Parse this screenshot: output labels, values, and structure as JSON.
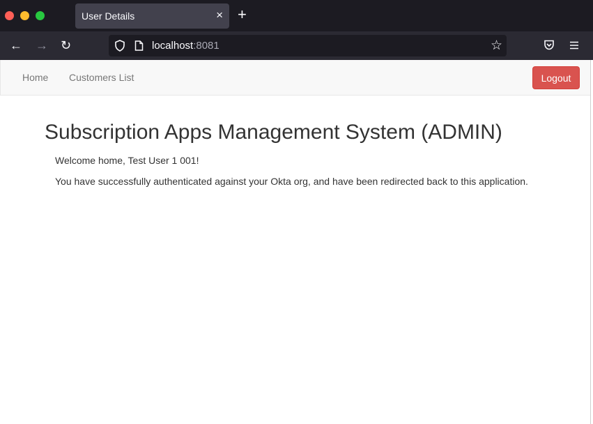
{
  "browser": {
    "tab_title": "User Details",
    "close_glyph": "×",
    "new_tab_glyph": "+",
    "url_host": "localhost",
    "url_port": ":8081",
    "back_glyph": "←",
    "forward_glyph": "→",
    "reload_glyph": "↻",
    "star_glyph": "☆",
    "icons": [
      "back-icon",
      "forward-icon",
      "reload-icon",
      "shield-icon",
      "page-icon",
      "star-icon",
      "pocket-icon",
      "menu-icon"
    ]
  },
  "nav": {
    "home": "Home",
    "customers": "Customers List",
    "logout": "Logout"
  },
  "main": {
    "title": "Subscription Apps Management System (ADMIN)",
    "welcome": "Welcome home, Test User 1 001!",
    "message": "You have successfully authenticated against your Okta org, and have been redirected back to this application."
  },
  "colors": {
    "logout_bg": "#d9534f",
    "chrome_dark": "#1c1b22",
    "toolbar": "#2b2a33"
  }
}
